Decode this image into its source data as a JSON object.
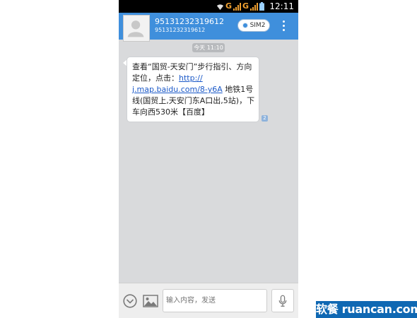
{
  "status_bar": {
    "network_label_1": "G",
    "network_label_2": "G",
    "time": "12:11",
    "icons": [
      "wifi-icon",
      "signal-icon",
      "signal-icon",
      "battery-icon"
    ]
  },
  "header": {
    "contact_name": "95131232319612",
    "contact_number": "95131232319612",
    "sim_button_label": "SIM2",
    "avatar_icon": "person-icon",
    "menu_icon": "more-vert-icon"
  },
  "conversation": {
    "date_chip": "今天 11:10",
    "message": {
      "line1": "查看“国贸-天安门”步行指引、方向",
      "line2_prefix": "定位，点击：",
      "line2_link": "http://",
      "line3_link": "j.map.baidu.com/8-y6A",
      "line3_suffix": "地铁1号",
      "line4": "线(国贸上,天安门东A口出,5站)，下",
      "line5": "车向西530米【百度】",
      "sim_indicator": "2"
    }
  },
  "composer": {
    "input_placeholder": "输入内容，发送",
    "expand_icon": "chevron-down-circle-icon",
    "image_icon": "image-icon",
    "voice_icon": "microphone-icon"
  },
  "watermark": {
    "text": "软餐 ruancan.com"
  },
  "colors": {
    "header": "#3f8fdc",
    "background": "#d9dadc",
    "link": "#1a58c8",
    "watermark": "#0f68b3"
  }
}
